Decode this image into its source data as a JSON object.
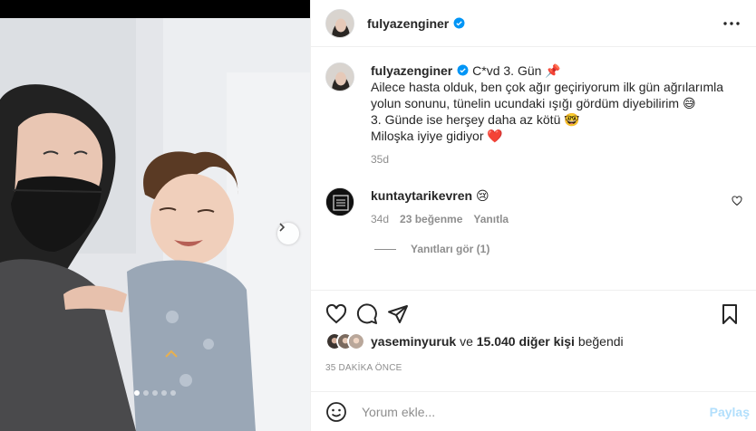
{
  "post": {
    "author": "fulyazenginer",
    "verified": true,
    "carousel": {
      "total": 5,
      "active": 1
    }
  },
  "caption": {
    "username": "fulyazenginer",
    "lines": [
      "C*vd 3. Gün 📌",
      "Ailece hasta olduk, ben çok ağır geçiriyorum ilk gün ağrılarımla",
      "yolun sonunu, tünelin ucundaki ışığı gördüm diyebilirim 😅",
      "3. Günde ise herşey daha az kötü 🤓",
      "Miloşka iyiye gidiyor ❤️"
    ],
    "age": "35d"
  },
  "comment": {
    "username": "kuntaytarikevren",
    "text": "😢",
    "age": "34d",
    "likes": "23 beğenme",
    "reply": "Yanıtla",
    "view_replies": "Yanıtları gör (1)"
  },
  "likes": {
    "user": "yaseminyuruk",
    "connector": "ve",
    "others": "15.040 diğer kişi",
    "suffix": "beğendi"
  },
  "timestamp": "35 DAKİKA ÖNCE",
  "add_comment": {
    "placeholder": "Yorum ekle...",
    "post_label": "Paylaş"
  },
  "colors": {
    "verified": "#0095f6",
    "post_disabled": "#b2dffc",
    "secondary_text": "#8e8e8e",
    "border": "#efefef"
  },
  "icons": [
    "verified-badge-icon",
    "more-options-icon",
    "chevron-right-icon",
    "heart-icon",
    "comment-icon",
    "share-icon",
    "bookmark-icon",
    "emoji-icon"
  ]
}
